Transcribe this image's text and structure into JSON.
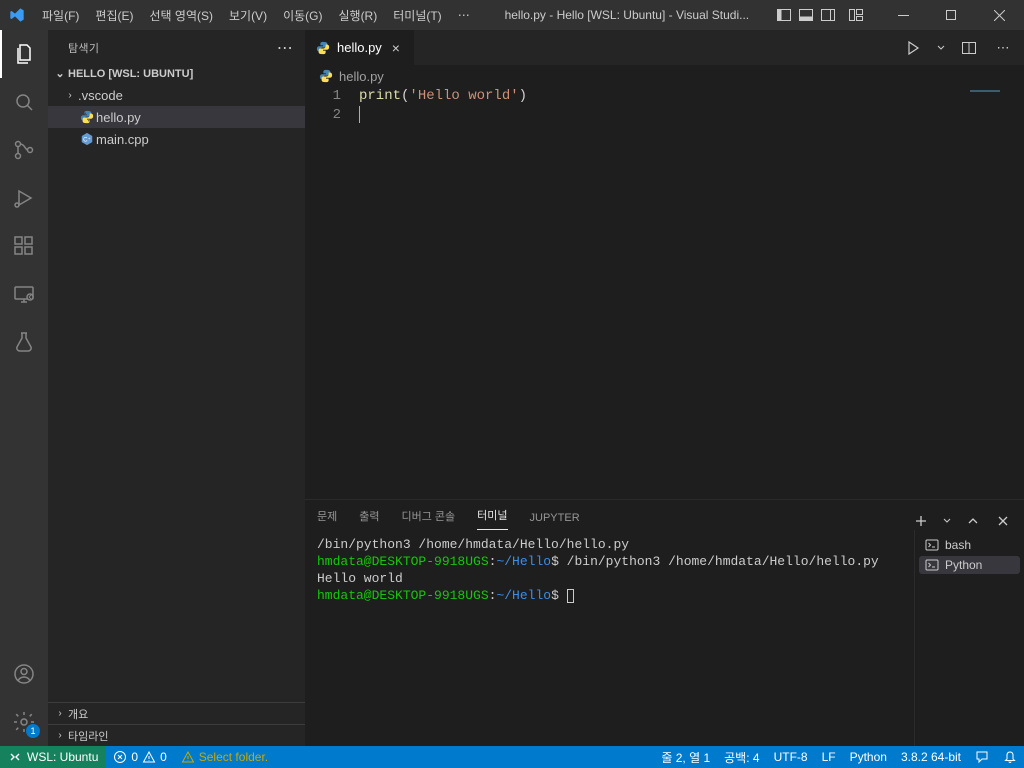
{
  "titlebar": {
    "menu": [
      "파일(F)",
      "편집(E)",
      "선택 영역(S)",
      "보기(V)",
      "이동(G)",
      "실행(R)",
      "터미널(T)",
      "⋯"
    ],
    "title": "hello.py - Hello [WSL: Ubuntu] - Visual Studi..."
  },
  "sidebar": {
    "title": "탐색기",
    "root": "HELLO [WSL: UBUNTU]",
    "items": [
      {
        "name": ".vscode",
        "type": "folder"
      },
      {
        "name": "hello.py",
        "type": "py",
        "selected": true
      },
      {
        "name": "main.cpp",
        "type": "cpp"
      }
    ],
    "collapsed": [
      "개요",
      "타임라인"
    ]
  },
  "tabs": {
    "open": [
      {
        "name": "hello.py"
      }
    ]
  },
  "breadcrumb": {
    "file": "hello.py"
  },
  "editor": {
    "lines": [
      "1",
      "2"
    ],
    "code_fn": "print",
    "code_open": "(",
    "code_str": "'Hello world'",
    "code_close": ")"
  },
  "panel": {
    "tabs": [
      "문제",
      "출력",
      "디버그 콘솔",
      "터미널",
      "JUPYTER"
    ],
    "active": 3,
    "sessions": [
      "bash",
      "Python"
    ],
    "active_session": 1,
    "terminal": {
      "l1": "/bin/python3 /home/hmdata/Hello/hello.py",
      "l2_user": "hmdata@DESKTOP-9918UGS",
      "l2_colon": ":",
      "l2_path": "~/Hello",
      "l2_dollar": "$ ",
      "l2_cmd": "/bin/python3 /home/hmdata/Hello/hello.py",
      "l3": "Hello world"
    }
  },
  "status": {
    "remote": "WSL: Ubuntu",
    "errors": "0",
    "warnings": "0",
    "select_folder": "Select folder.",
    "lncol": "줄 2, 열 1",
    "spaces": "공백: 4",
    "encoding": "UTF-8",
    "eol": "LF",
    "lang": "Python",
    "interpreter": "3.8.2 64-bit"
  },
  "gear_badge": "1"
}
